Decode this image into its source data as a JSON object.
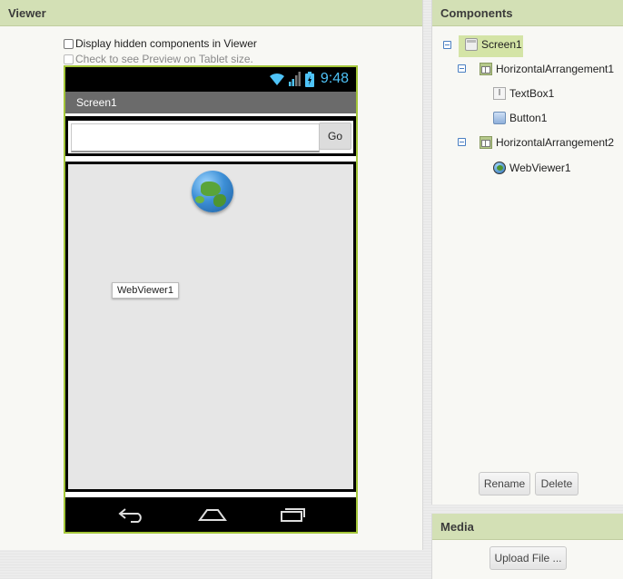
{
  "viewer": {
    "header": "Viewer",
    "show_hidden_label": "Display hidden components in Viewer",
    "tablet_preview_label": "Check to see Preview on Tablet size."
  },
  "phone": {
    "clock": "9:48",
    "screen_title": "Screen1",
    "go_button_label": "Go",
    "webviewer_label": "WebViewer1"
  },
  "components": {
    "header": "Components",
    "tree": [
      {
        "label": "Screen1",
        "icon": "screen-icon",
        "selected": true
      },
      {
        "label": "HorizontalArrangement1",
        "icon": "horizontal-arrangement-icon"
      },
      {
        "label": "TextBox1",
        "icon": "textbox-icon"
      },
      {
        "label": "Button1",
        "icon": "button-icon"
      },
      {
        "label": "HorizontalArrangement2",
        "icon": "horizontal-arrangement-icon"
      },
      {
        "label": "WebViewer1",
        "icon": "webviewer-icon"
      }
    ],
    "rename_label": "Rename",
    "delete_label": "Delete"
  },
  "media": {
    "header": "Media",
    "upload_label": "Upload File ..."
  },
  "colors": {
    "header_green": "#d3e0b5",
    "phone_border": "#a4c639",
    "selection": "#d4e4a6"
  }
}
